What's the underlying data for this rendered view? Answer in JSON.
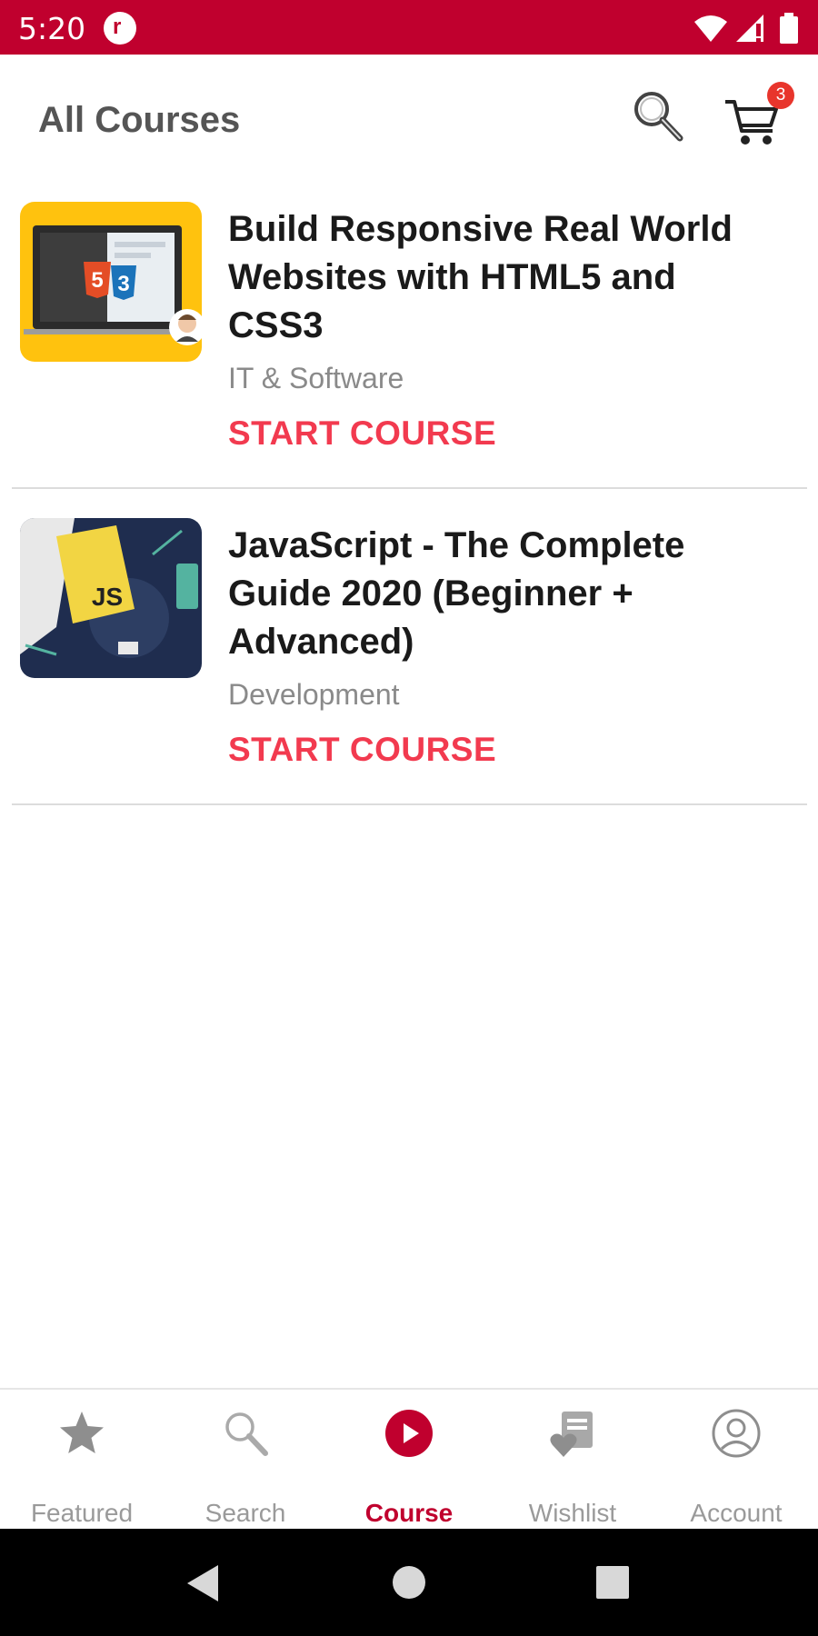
{
  "status_bar": {
    "time": "5:20",
    "notification_glyph": "r",
    "icons": [
      "notification-icon",
      "wifi-icon",
      "signal-icon",
      "battery-icon"
    ]
  },
  "app_bar": {
    "title": "All Courses",
    "cart_count": "3",
    "icons": [
      "search-icon",
      "cart-icon"
    ]
  },
  "courses": [
    {
      "title": "Build Responsive Real World Websites with HTML5 and CSS3",
      "category": "IT & Software",
      "action": "START COURSE",
      "thumb_badges": [
        "5",
        "3"
      ]
    },
    {
      "title": "JavaScript - The Complete Guide 2020 (Beginner + Advanced)",
      "category": "Development",
      "action": "START COURSE",
      "thumb_badges": [
        "JS"
      ]
    }
  ],
  "bottom_nav": {
    "items": [
      {
        "label": "Featured",
        "icon": "star-icon",
        "active": false
      },
      {
        "label": "Search",
        "icon": "search-icon",
        "active": false
      },
      {
        "label": "Course",
        "icon": "play-circle-icon",
        "active": true
      },
      {
        "label": "Wishlist",
        "icon": "wishlist-icon",
        "active": false
      },
      {
        "label": "Account",
        "icon": "account-icon",
        "active": false
      }
    ]
  },
  "colors": {
    "brand": "#c0002e",
    "accent": "#f23a4f",
    "badge": "#e8352c",
    "inactive": "#9a9a9a"
  }
}
